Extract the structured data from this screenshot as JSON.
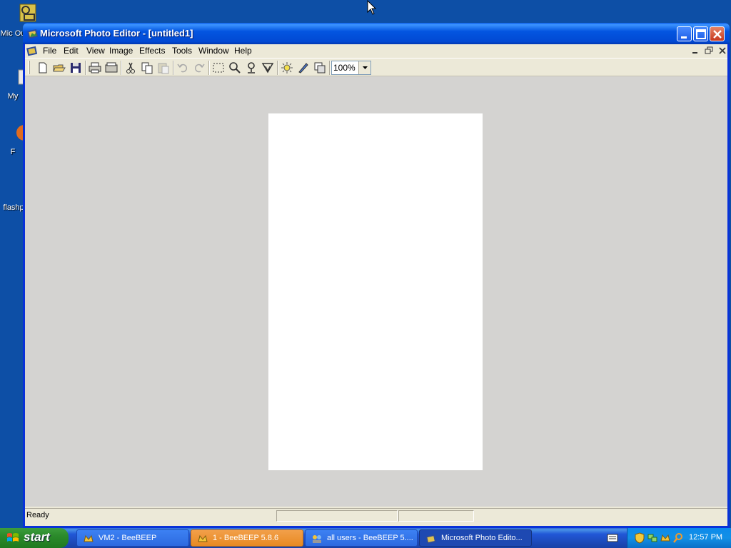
{
  "desktop": {
    "icons": [
      {
        "label": "Mic Ou",
        "icon": "outlook-icon"
      },
      {
        "label": "My",
        "icon": "my-documents-icon"
      },
      {
        "label": "F",
        "icon": "firefox-icon"
      },
      {
        "label": "flashp",
        "icon": "flash-icon"
      }
    ]
  },
  "window": {
    "title": "Microsoft Photo Editor - [untitled1]"
  },
  "menu": {
    "items": [
      "File",
      "Edit",
      "View",
      "Image",
      "Effects",
      "Tools",
      "Window",
      "Help"
    ]
  },
  "toolbar": {
    "zoom_value": "100%"
  },
  "statusbar": {
    "text": "Ready"
  },
  "taskbar": {
    "start_label": "start",
    "tasks": [
      {
        "label": "VM2 - BeeBEEP",
        "state": "normal"
      },
      {
        "label": "1 - BeeBEEP 5.8.6",
        "state": "flash"
      },
      {
        "label": "all users - BeeBEEP 5....",
        "state": "normal"
      },
      {
        "label": "Microsoft Photo Edito...",
        "state": "active"
      }
    ],
    "clock": "12:57 PM"
  },
  "colors": {
    "desktop": "#0d4fa6",
    "title_blue": "#0355e0",
    "canvas_gray": "#d4d3d1"
  }
}
